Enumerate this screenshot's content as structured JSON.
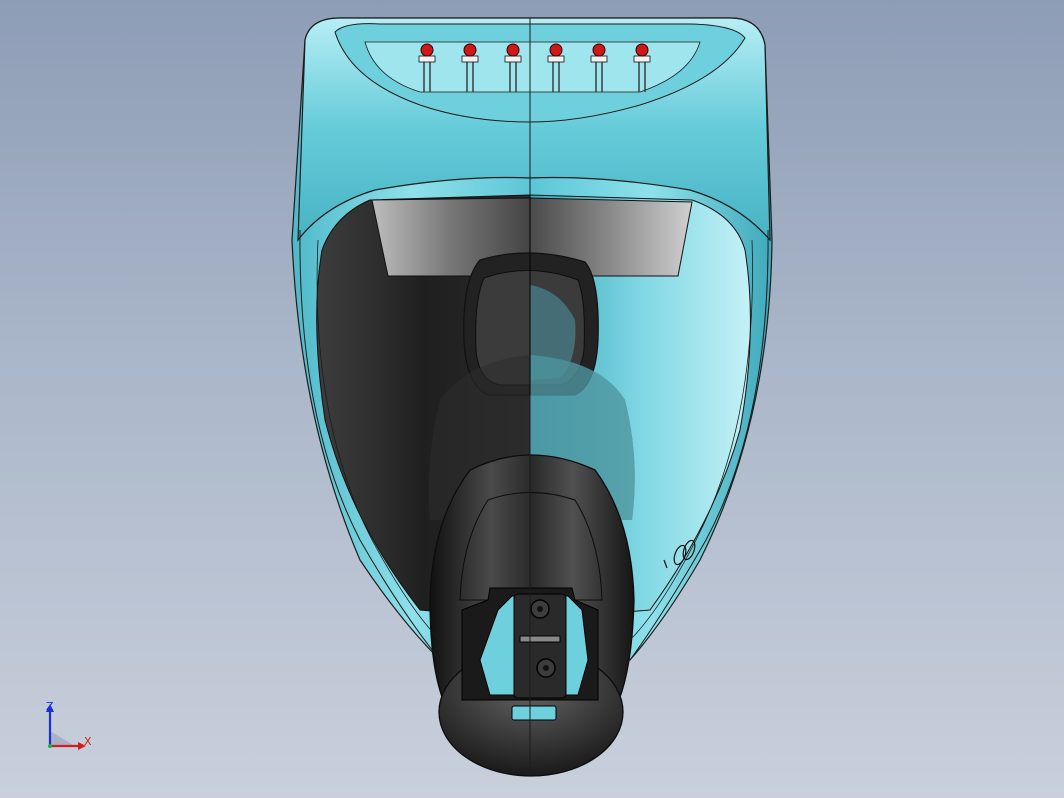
{
  "viewport": {
    "background_top": "#8e9db6",
    "background_bottom": "#c9d0dc"
  },
  "model": {
    "body_color": "#5fc9d8",
    "body_highlight": "#c8f3f8",
    "dark_color": "#2e2e2e",
    "led_color": "#d01818",
    "led_count": 6
  },
  "triad": {
    "z_label": "Z",
    "x_label": "X",
    "z_color": "#1a2fd6",
    "x_color": "#d41c1c"
  }
}
